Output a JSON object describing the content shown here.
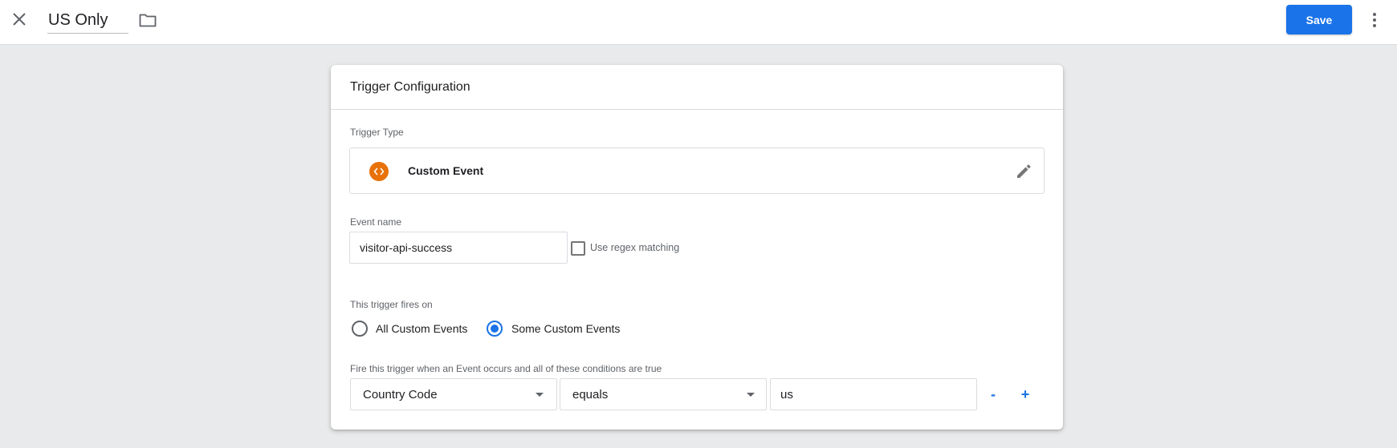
{
  "header": {
    "title": "US Only",
    "save_label": "Save"
  },
  "card": {
    "title": "Trigger Configuration",
    "trigger_type_label": "Trigger Type",
    "trigger_type_name": "Custom Event",
    "event_name_label": "Event name",
    "event_name_value": "visitor-api-success",
    "regex_label": "Use regex matching",
    "regex_checked": false,
    "fires_on_label": "This trigger fires on",
    "fires_on_options": [
      {
        "label": "All Custom Events",
        "selected": false
      },
      {
        "label": "Some Custom Events",
        "selected": true
      }
    ],
    "conditions_label": "Fire this trigger when an Event occurs and all of these conditions are true",
    "condition": {
      "variable": "Country Code",
      "operator": "equals",
      "value": "us",
      "remove_label": "-",
      "add_label": "+"
    }
  },
  "colors": {
    "accent": "#1a73e8",
    "trigger_icon": "#e8710a",
    "background": "#e9eaeb"
  },
  "icons": [
    "close-icon",
    "folder-icon",
    "more-vert-icon",
    "custom-event-icon",
    "edit-pencil-icon"
  ]
}
